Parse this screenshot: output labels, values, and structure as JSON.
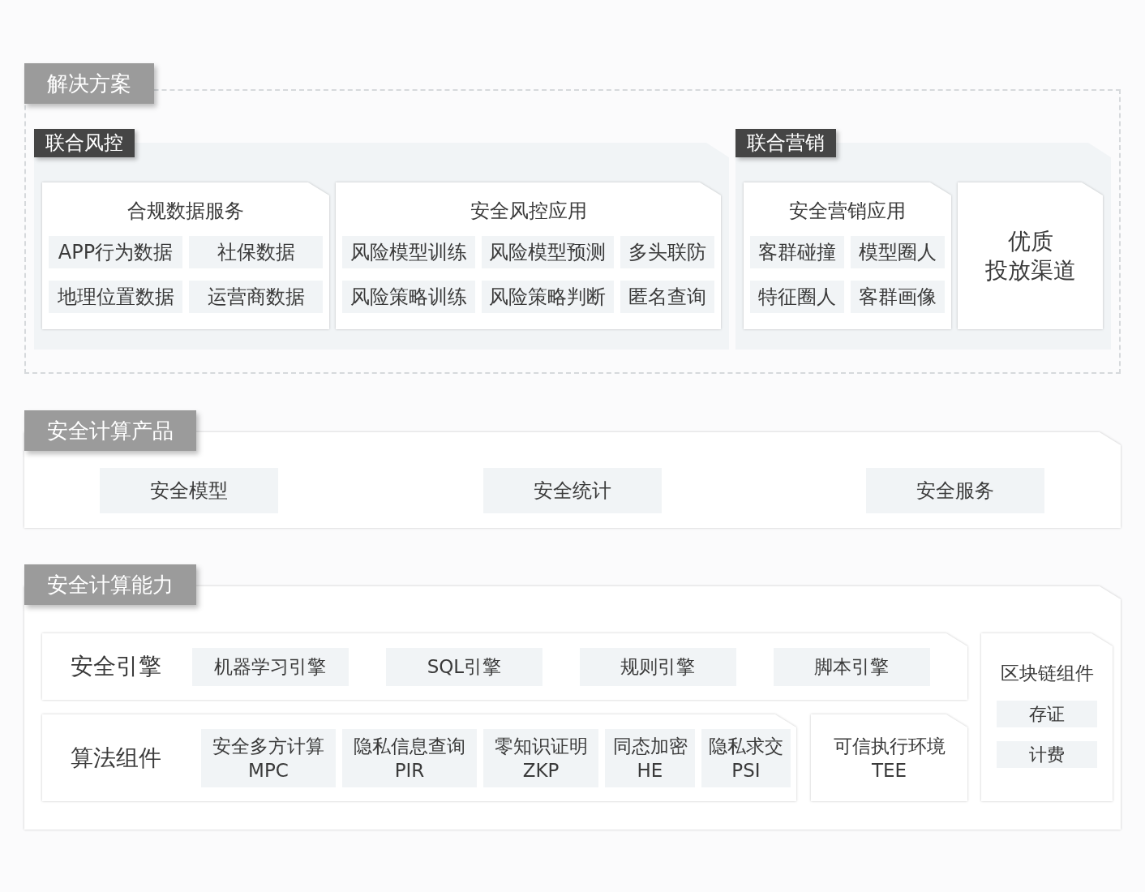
{
  "sections": [
    {
      "kind": "solutions",
      "title": "解决方案",
      "groups": [
        {
          "title": "联合风控",
          "cards": [
            {
              "kind": "list",
              "title": "合规数据服务",
              "items": [
                "APP行为数据",
                "社保数据",
                "地理位置数据",
                "运营商数据"
              ]
            },
            {
              "kind": "list",
              "title": "安全风控应用",
              "items": [
                "风险模型训练",
                "风险模型预测",
                "多头联防",
                "风险策略训练",
                "风险策略判断",
                "匿名查询"
              ]
            }
          ]
        },
        {
          "title": "联合营销",
          "cards": [
            {
              "kind": "list",
              "title": "安全营销应用",
              "items": [
                "客群碰撞",
                "模型圈人",
                "特征圈人",
                "客群画像"
              ]
            },
            {
              "kind": "headline",
              "title_lines": [
                "优质",
                "投放渠道"
              ]
            }
          ]
        }
      ]
    },
    {
      "kind": "products",
      "title": "安全计算产品",
      "items": [
        "安全模型",
        "安全统计",
        "安全服务"
      ]
    },
    {
      "kind": "capabilities",
      "title": "安全计算能力",
      "engine": {
        "label": "安全引擎",
        "items": [
          "机器学习引擎",
          "SQL引擎",
          "规则引擎",
          "脚本引擎"
        ]
      },
      "algorithms": {
        "label": "算法组件",
        "items": [
          {
            "name": "安全多方计算",
            "abbr": "MPC"
          },
          {
            "name": "隐私信息查询",
            "abbr": "PIR"
          },
          {
            "name": "零知识证明",
            "abbr": "ZKP"
          },
          {
            "name": "同态加密",
            "abbr": "HE"
          },
          {
            "name": "隐私求交",
            "abbr": "PSI"
          }
        ]
      },
      "tee": {
        "name": "可信执行环境",
        "abbr": "TEE"
      },
      "blockchain": {
        "title": "区块链组件",
        "items": [
          "存证",
          "计费"
        ]
      }
    }
  ]
}
